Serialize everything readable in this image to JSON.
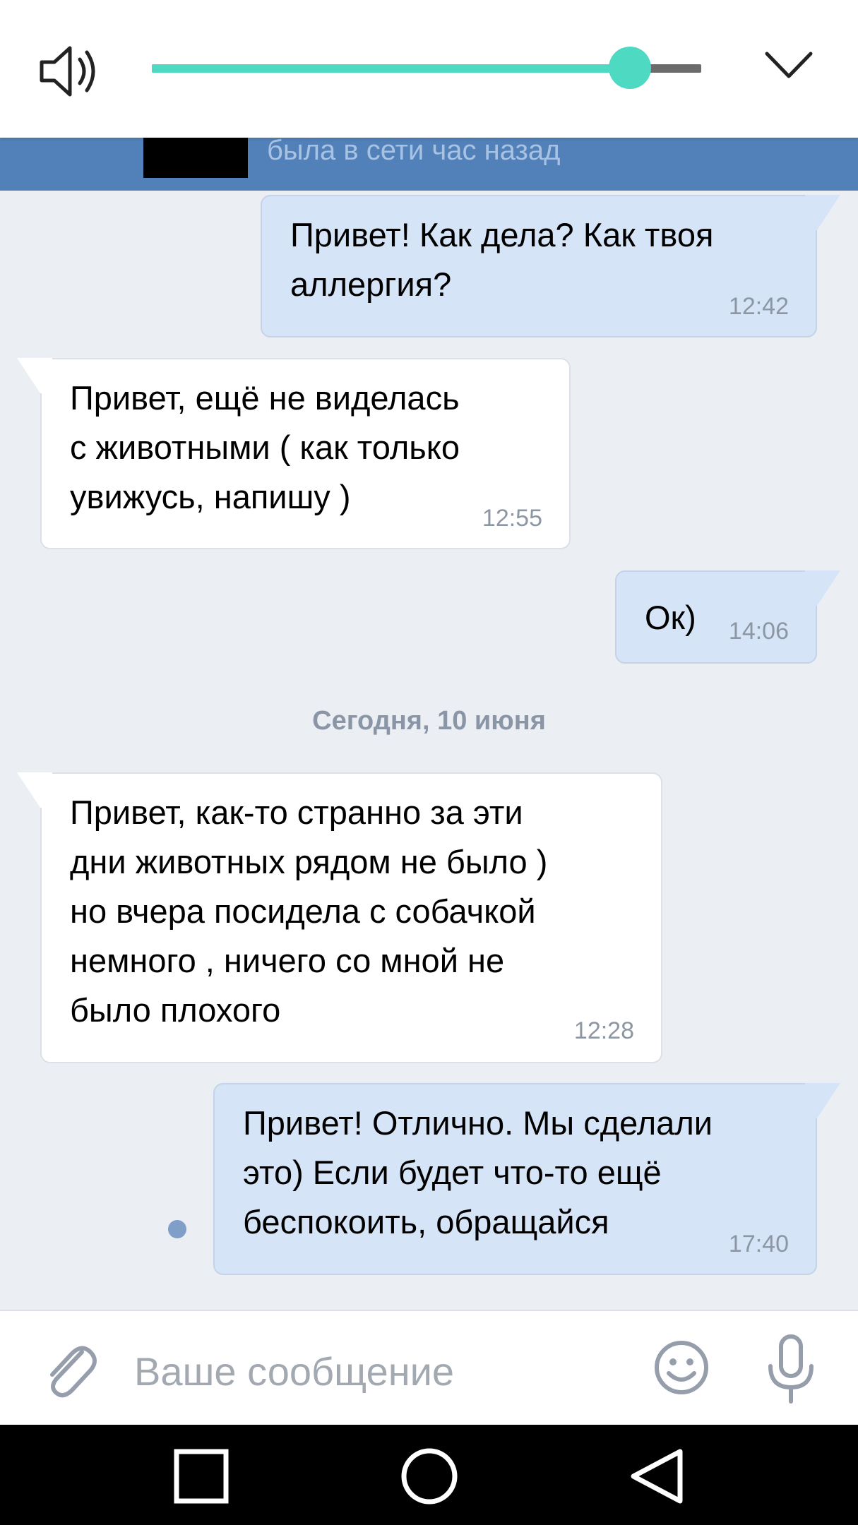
{
  "volume": {
    "level": 0.87
  },
  "header": {
    "status": "была в сети час назад"
  },
  "messages": [
    {
      "dir": "out",
      "text": "Привет! Как дела? Как твоя\nаллергия?",
      "time": "12:42"
    },
    {
      "dir": "in",
      "text": "Привет, ещё не виделась\nс животными ( как только\nувижусь, напишу )",
      "time": "12:55"
    },
    {
      "dir": "out",
      "text": "Ок)",
      "time": "14:06"
    },
    {
      "dir": "in",
      "text": "Привет, как-то странно за эти\nдни животных рядом не было )\nно вчера посидела с собачкой\nнемного , ничего со мной не\nбыло плохого",
      "time": "12:28"
    },
    {
      "dir": "out",
      "text": "Привет! Отлично. Мы сделали\nэто) Если будет что-то ещё\nбеспокоить, обращайся",
      "time": "17:40"
    }
  ],
  "date_separator": "Сегодня, 10 июня",
  "composer": {
    "placeholder": "Ваше сообщение"
  },
  "colors": {
    "accent": "#4dd9c2",
    "header": "#5281b9",
    "outgoing_bubble": "#d6e4f7",
    "incoming_bubble": "#ffffff",
    "background": "#ebeef3"
  },
  "icons": [
    "speaker-icon",
    "chevron-down-icon",
    "paperclip-icon",
    "smiley-icon",
    "microphone-icon",
    "recent-apps-icon",
    "home-icon",
    "back-icon"
  ]
}
